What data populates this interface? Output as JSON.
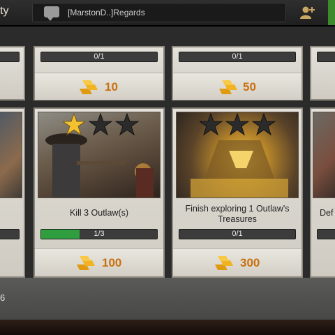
{
  "topbar": {
    "title_fragment": "ty",
    "chat_text": "[MarstonD..]Regards",
    "colors": {
      "accent_green": "#3c8a2a"
    }
  },
  "row1": [
    {
      "progress_text": "",
      "reward": ""
    },
    {
      "progress_text": "0/1",
      "reward": "10"
    },
    {
      "progress_text": "0/1",
      "reward": "50"
    },
    {
      "progress_text": "",
      "reward": ""
    }
  ],
  "row2": [
    {
      "title": "",
      "progress_text": "",
      "reward": "",
      "stars_filled": 0
    },
    {
      "title": "Kill 3 Outlaw(s)",
      "progress_text": "1/3",
      "progress_value": 0.333,
      "reward": "100",
      "stars_filled": 1,
      "stars_total": 3
    },
    {
      "title": "Finish exploring 1 Outlaw's Treasures",
      "progress_text": "0/1",
      "progress_value": 0,
      "reward": "300",
      "stars_filled": 0,
      "stars_total": 3
    },
    {
      "title": "Def",
      "progress_text": "",
      "reward": ""
    }
  ],
  "bottom": {
    "text": "6"
  },
  "icons": {
    "chat": "chat-bubble-icon",
    "friends": "add-friend-icon",
    "gold": "gold-bars-icon",
    "star": "star-icon"
  }
}
